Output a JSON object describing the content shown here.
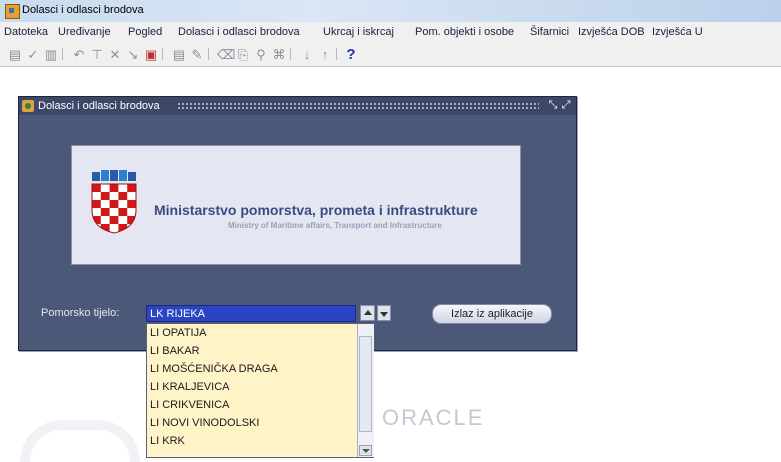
{
  "window": {
    "title": "Dolasci i odlasci brodova"
  },
  "menubar": {
    "items": [
      "Datoteka",
      "Uređivanje",
      "Pogled",
      "Dolasci i odlasci brodova",
      "Ukrcaj i iskrcaj",
      "Pom. objekti i osobe",
      "Šifarnici",
      "Izvješća DOB",
      "Izvješća U"
    ]
  },
  "toolbar": {
    "icons": [
      "save-icon",
      "check-icon",
      "print-icon",
      "undo-icon",
      "filter-icon",
      "clear-filter-icon",
      "search-icon",
      "window-icon",
      "record-icon",
      "edit-icon",
      "delete-icon",
      "copy-icon",
      "paste-icon",
      "insert-icon",
      "down-icon",
      "up-icon",
      "help-icon"
    ],
    "help_label": "?"
  },
  "form": {
    "title": "Dolasci i odlasci brodova",
    "banner": {
      "title_hr": "Ministarstvo pomorstva, prometa i infrastrukture",
      "title_en": "Ministry of Maritime affairs, Transport and Infrastructure"
    },
    "field_label": "Pomorsko tijelo:",
    "selected_value": "LK RIJEKA",
    "exit_button": "Izlaz iz aplikacije"
  },
  "dropdown": {
    "options": [
      "LI OPATIJA",
      "LI BAKAR",
      "LI MOŠĆENIČKA DRAGA",
      "LI KRALJEVICA",
      "LI CRIKVENICA",
      "LI NOVI VINODOLSKI",
      "LI KRK"
    ]
  },
  "watermark": {
    "text": "ORACLE"
  },
  "colors": {
    "form_bg": "#4b5878",
    "selection": "#2a44c4",
    "dropdown_bg": "#fff3c8",
    "ministry_text": "#3a4a82"
  }
}
